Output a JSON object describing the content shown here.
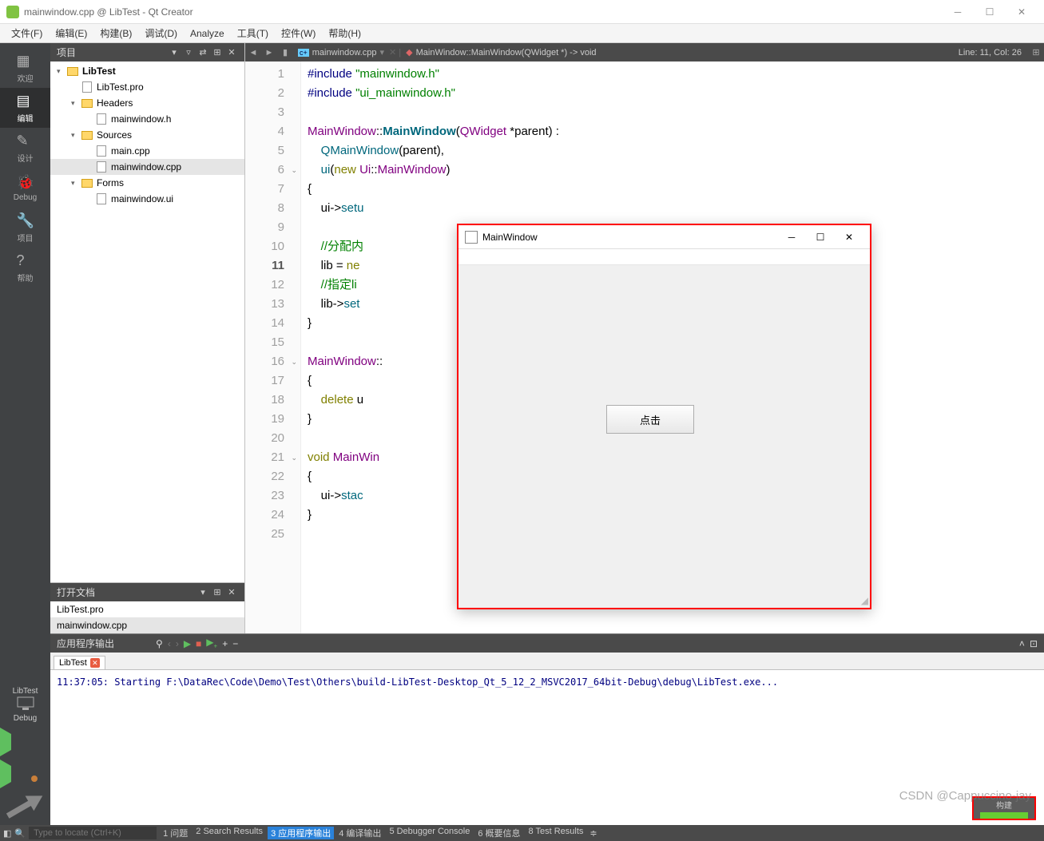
{
  "title": "mainwindow.cpp @ LibTest - Qt Creator",
  "menus": [
    "文件(F)",
    "编辑(E)",
    "构建(B)",
    "调试(D)",
    "Analyze",
    "工具(T)",
    "控件(W)",
    "帮助(H)"
  ],
  "modes": [
    {
      "label": "欢迎",
      "icon": "grid"
    },
    {
      "label": "编辑",
      "icon": "edit",
      "active": true
    },
    {
      "label": "设计",
      "icon": "pencil"
    },
    {
      "label": "Debug",
      "icon": "bug"
    },
    {
      "label": "项目",
      "icon": "wrench"
    },
    {
      "label": "帮助",
      "icon": "help"
    }
  ],
  "kit": {
    "name": "LibTest",
    "mode": "Debug",
    "icon": "monitor"
  },
  "project_header": "项目",
  "tree": [
    {
      "d": 0,
      "exp": "v",
      "icon": "folder",
      "label": "LibTest",
      "bold": true
    },
    {
      "d": 1,
      "exp": "",
      "icon": "pro",
      "label": "LibTest.pro"
    },
    {
      "d": 1,
      "exp": "v",
      "icon": "folder",
      "label": "Headers"
    },
    {
      "d": 2,
      "exp": "",
      "icon": "h",
      "label": "mainwindow.h"
    },
    {
      "d": 1,
      "exp": "v",
      "icon": "folder",
      "label": "Sources"
    },
    {
      "d": 2,
      "exp": "",
      "icon": "cpp",
      "label": "main.cpp"
    },
    {
      "d": 2,
      "exp": "",
      "icon": "cpp",
      "label": "mainwindow.cpp",
      "sel": true
    },
    {
      "d": 1,
      "exp": "v",
      "icon": "folder",
      "label": "Forms"
    },
    {
      "d": 2,
      "exp": "",
      "icon": "ui",
      "label": "mainwindow.ui"
    }
  ],
  "opendocs_header": "打开文档",
  "opendocs": [
    {
      "label": "LibTest.pro"
    },
    {
      "label": "mainwindow.cpp",
      "sel": true
    }
  ],
  "editor_crumb": {
    "file": "mainwindow.cpp",
    "symbol": "MainWindow::MainWindow(QWidget *) -> void"
  },
  "cursor": "Line: 11, Col: 26",
  "code_lines": [
    {
      "n": 1,
      "h": "<span class='pp'>#include</span> <span class='str'>\"mainwindow.h\"</span>"
    },
    {
      "n": 2,
      "h": "<span class='pp'>#include</span> <span class='str'>\"ui_mainwindow.h\"</span>"
    },
    {
      "n": 3,
      "h": ""
    },
    {
      "n": 4,
      "h": "<span class='ty'>MainWindow</span>::<span class='fnb'>MainWindow</span>(<span class='ty'>QWidget</span> *parent) :"
    },
    {
      "n": 5,
      "h": "    <span class='fn'>QMainWindow</span>(parent),"
    },
    {
      "n": 6,
      "fold": true,
      "h": "    <span class='fn'>ui</span>(<span class='kw'>new</span> <span class='ty'>Ui</span>::<span class='ty'>MainWindow</span>)"
    },
    {
      "n": 7,
      "h": "{"
    },
    {
      "n": 8,
      "h": "    ui-&gt;<span class='fn'>setu</span>"
    },
    {
      "n": 9,
      "h": ""
    },
    {
      "n": 10,
      "h": "    <span class='cm'>//分配内</span>"
    },
    {
      "n": 11,
      "cur": true,
      "h": "    lib = <span class='kw'>ne</span>"
    },
    {
      "n": 12,
      "h": "    <span class='cm'>//指定li</span>                                                             <span class='cm'>get的第二页</span>"
    },
    {
      "n": 13,
      "h": "    lib-&gt;<span class='fn'>set</span>"
    },
    {
      "n": 14,
      "h": "}"
    },
    {
      "n": 15,
      "h": ""
    },
    {
      "n": 16,
      "fold": true,
      "h": "<span class='ty'>MainWindow</span>::"
    },
    {
      "n": 17,
      "h": "{"
    },
    {
      "n": 18,
      "h": "    <span class='kw'>delete</span> u"
    },
    {
      "n": 19,
      "h": "}"
    },
    {
      "n": 20,
      "h": ""
    },
    {
      "n": 21,
      "fold": true,
      "h": "<span class='kw'>void</span> <span class='ty'>MainWin</span>"
    },
    {
      "n": 22,
      "h": "{"
    },
    {
      "n": 23,
      "h": "    ui-&gt;<span class='fn'>stac</span>"
    },
    {
      "n": 24,
      "h": "}"
    },
    {
      "n": 25,
      "h": ""
    }
  ],
  "output": {
    "title": "应用程序输出",
    "tab": "LibTest",
    "text": "11:37:05: Starting F:\\DataRec\\Code\\Demo\\Test\\Others\\build-LibTest-Desktop_Qt_5_12_2_MSVC2017_64bit-Debug\\debug\\LibTest.exe..."
  },
  "status": {
    "locator_placeholder": "Type to locate (Ctrl+K)",
    "panes": [
      "1 问题",
      "2 Search Results",
      "3 应用程序输出",
      "4 编译输出",
      "5 Debugger Console",
      "6 概要信息",
      "8 Test Results"
    ],
    "active_pane": 2
  },
  "build_badge": {
    "label": "构建"
  },
  "popup": {
    "title": "MainWindow",
    "button": "点击"
  },
  "watermark": "CSDN @Cappuccino-jay"
}
